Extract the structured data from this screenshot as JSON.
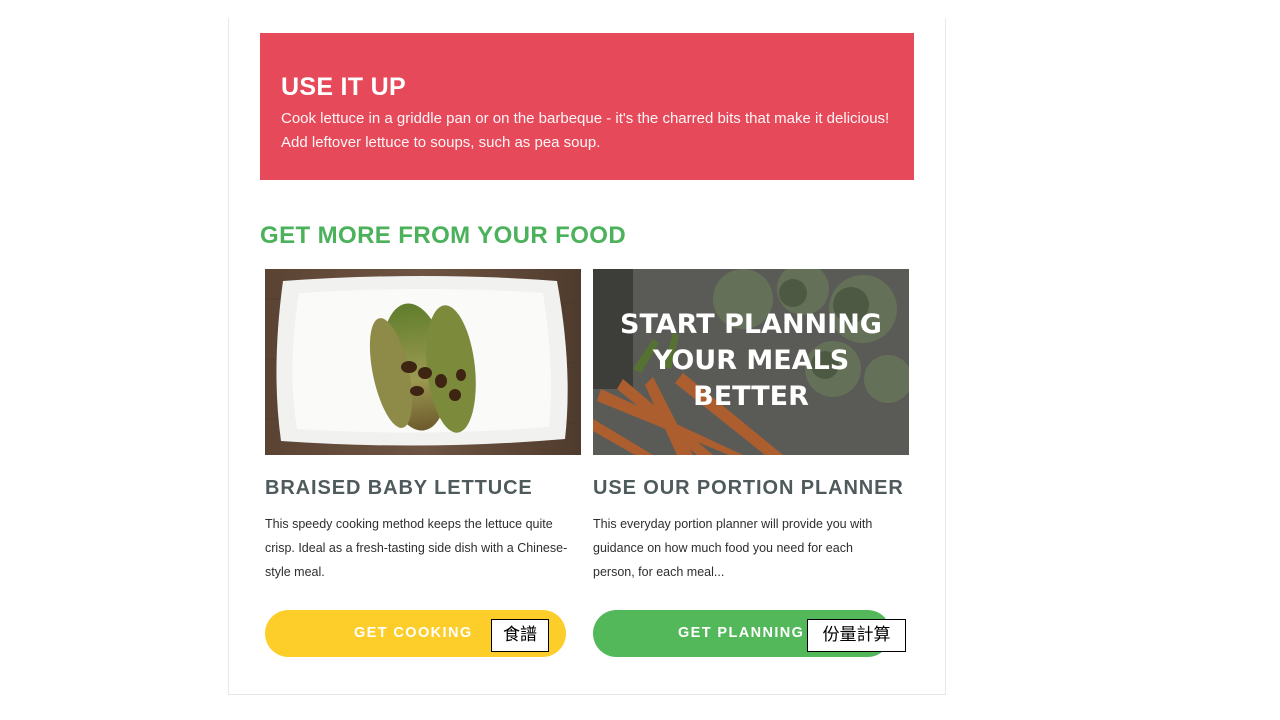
{
  "tip": {
    "heading": "USE IT UP",
    "line1": "Cook lettuce in a griddle pan or on the barbeque - it's the charred bits that make it delicious!",
    "line2": "Add leftover lettuce to soups, such as pea soup."
  },
  "section": {
    "title": "GET MORE FROM YOUR FOOD"
  },
  "cards": [
    {
      "title": "BRAISED BABY LETTUCE",
      "description": "This speedy cooking method keeps the lettuce quite crisp. Ideal as a fresh-tasting side dish with a Chinese-style meal.",
      "button_label": "GET COOKING",
      "button_color": "#fdcd2a",
      "overlay_label": "食譜"
    },
    {
      "title": "USE OUR PORTION PLANNER",
      "description": "This everyday portion planner will provide you with guidance on how much food you need for each person, for each meal...",
      "image_text": [
        "START PLANNING",
        "YOUR MEALS",
        "BETTER"
      ],
      "button_label": "GET PLANNING",
      "button_color": "#52b85a",
      "overlay_label": "份量計算"
    }
  ],
  "colors": {
    "banner": "#e64a5a",
    "section_title": "#4bb15a",
    "card_title": "#4f5a5c"
  }
}
